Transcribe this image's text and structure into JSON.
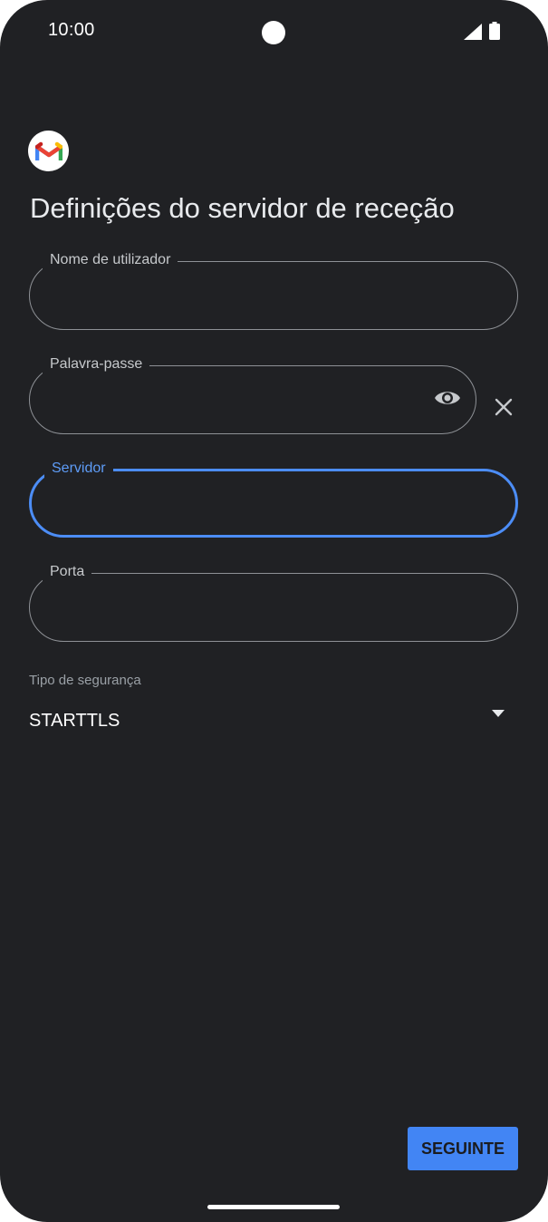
{
  "status_bar": {
    "time": "10:00"
  },
  "page": {
    "title": "Definições do servidor de receção"
  },
  "form": {
    "username": {
      "label": "Nome de utilizador",
      "value": ""
    },
    "password": {
      "label": "Palavra-passe",
      "value": ""
    },
    "server": {
      "label": "Servidor",
      "value": ""
    },
    "port": {
      "label": "Porta",
      "value": ""
    },
    "security_type": {
      "label": "Tipo de segurança",
      "value": "STARTTLS"
    }
  },
  "actions": {
    "next_label": "SEGUINTE"
  },
  "colors": {
    "background": "#202124",
    "accent": "#4285f4",
    "focus": "#4c8df6",
    "outline": "#8e9196"
  },
  "icons": [
    "gmail-logo-icon",
    "signal-icon",
    "battery-icon",
    "eye-icon",
    "close-icon",
    "dropdown-arrow-icon"
  ]
}
